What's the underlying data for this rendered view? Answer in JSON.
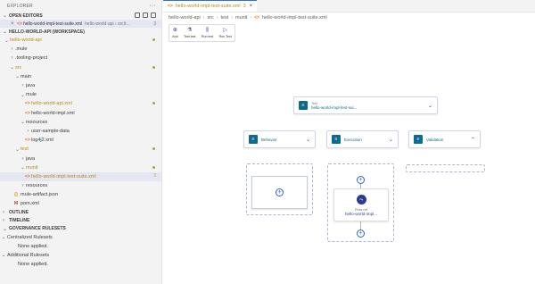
{
  "sidebar": {
    "title": "EXPLORER",
    "open_editors_label": "OPEN EDITORS",
    "open_editor": {
      "name": "hello-world-impl-test-suite.xml",
      "path": "hello-world-api › src/t...",
      "badge": "3"
    },
    "workspace_label": "HELLO-WORLD-API (WORKSPACE)",
    "tree": [
      {
        "label": "hello-world-api",
        "chev": "⌄",
        "indent": 4,
        "mod": true,
        "dot": true
      },
      {
        "label": ".mule",
        "chev": "›",
        "indent": 10
      },
      {
        "label": ".tooling-project",
        "chev": "›",
        "indent": 10
      },
      {
        "label": "src",
        "chev": "⌄",
        "indent": 10,
        "mod": true,
        "dot": true
      },
      {
        "label": "main",
        "chev": "⌄",
        "indent": 16
      },
      {
        "label": "java",
        "chev": "›",
        "indent": 22
      },
      {
        "label": "mule",
        "chev": "⌄",
        "indent": 22
      },
      {
        "label": "hello-world-api.xml",
        "icon": "xml",
        "indent": 28,
        "mod": true,
        "dot": true
      },
      {
        "label": "hello-world-impl.xml",
        "icon": "xml",
        "indent": 28
      },
      {
        "label": "resources",
        "chev": "⌄",
        "indent": 22
      },
      {
        "label": "user-sample-data",
        "chev": "›",
        "indent": 28
      },
      {
        "label": "log4j2.xml",
        "icon": "xml",
        "indent": 28
      },
      {
        "label": "test",
        "chev": "⌄",
        "indent": 16,
        "mod": true,
        "dot": true
      },
      {
        "label": "java",
        "chev": "›",
        "indent": 22
      },
      {
        "label": "munit",
        "chev": "⌄",
        "indent": 22,
        "mod": true,
        "dot": true
      },
      {
        "label": "hello-world-impl-test-suite.xml",
        "icon": "xml",
        "indent": 28,
        "mod": true,
        "num": "3",
        "selected": true
      },
      {
        "label": "resources",
        "chev": "›",
        "indent": 22
      },
      {
        "label": "mule-artifact.json",
        "icon": "json",
        "indent": 16
      },
      {
        "label": "pom.xml",
        "icon": "mvn",
        "indent": 16
      }
    ],
    "outline_label": "OUTLINE",
    "timeline_label": "TIMELINE",
    "governance_label": "GOVERNANCE RULESETS",
    "centralized_label": "Centralized Rulesets",
    "centralized_note": "None applied.",
    "additional_label": "Additional Rulesets",
    "additional_note": "None applied."
  },
  "editor": {
    "tab_label": "hello-world-impl-test-suite.xml",
    "tab_badge": "3",
    "breadcrumb": [
      "hello-world-api",
      "src",
      "test",
      "munit",
      "hello-world-impl-test-suite.xml"
    ],
    "toolbar": [
      {
        "icon": "⊕",
        "label": "Add"
      },
      {
        "icon": "⚗",
        "label": "Test test"
      },
      {
        "icon": "⫼",
        "label": "Run test"
      },
      {
        "icon": "▷",
        "label": "Run Test"
      }
    ],
    "test_card": {
      "key": "Test",
      "value": "hello-world-impl-test-sui..."
    },
    "behavior_label": "Behavior",
    "execution_label": "Execution",
    "validation_label": "Validation",
    "flow_ref": {
      "key": "Flow ref",
      "value": "hello-world-impl..."
    }
  }
}
